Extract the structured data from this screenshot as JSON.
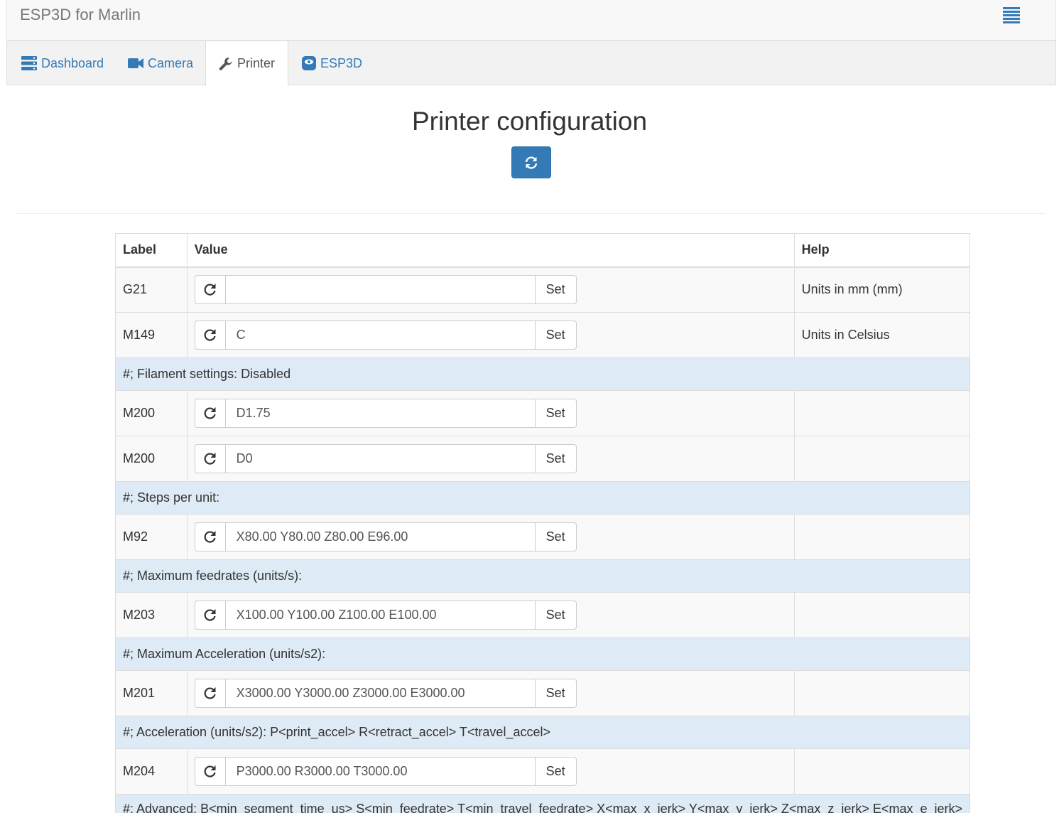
{
  "app": {
    "title": "ESP3D for Marlin",
    "menu_icon": "hamburger-menu-icon"
  },
  "tabs": [
    {
      "label": "Dashboard",
      "icon": "dashboard-icon",
      "active": false
    },
    {
      "label": "Camera",
      "icon": "camera-icon",
      "active": false
    },
    {
      "label": "Printer",
      "icon": "wrench-icon",
      "active": true
    },
    {
      "label": "ESP3D",
      "icon": "esp3d-icon",
      "active": false
    }
  ],
  "page": {
    "title": "Printer configuration",
    "refresh_icon": "refresh-icon"
  },
  "table": {
    "headers": {
      "label": "Label",
      "value": "Value",
      "help": "Help"
    },
    "set_label": "Set",
    "rows": [
      {
        "type": "setting",
        "label": "G21",
        "value": "",
        "help": "Units in mm (mm)"
      },
      {
        "type": "setting",
        "label": "M149",
        "value": "C",
        "help": "Units in Celsius"
      },
      {
        "type": "section",
        "text": "#; Filament settings: Disabled"
      },
      {
        "type": "setting",
        "label": "M200",
        "value": "D1.75",
        "help": ""
      },
      {
        "type": "setting",
        "label": "M200",
        "value": "D0",
        "help": ""
      },
      {
        "type": "section",
        "text": "#; Steps per unit:"
      },
      {
        "type": "setting",
        "label": "M92",
        "value": "X80.00 Y80.00 Z80.00 E96.00",
        "help": ""
      },
      {
        "type": "section",
        "text": "#; Maximum feedrates (units/s):"
      },
      {
        "type": "setting",
        "label": "M203",
        "value": "X100.00 Y100.00 Z100.00 E100.00",
        "help": ""
      },
      {
        "type": "section",
        "text": "#; Maximum Acceleration (units/s2):"
      },
      {
        "type": "setting",
        "label": "M201",
        "value": "X3000.00 Y3000.00 Z3000.00 E3000.00",
        "help": ""
      },
      {
        "type": "section",
        "text": "#; Acceleration (units/s2): P<print_accel> R<retract_accel> T<travel_accel>"
      },
      {
        "type": "setting",
        "label": "M204",
        "value": "P3000.00 R3000.00 T3000.00",
        "help": ""
      },
      {
        "type": "section",
        "text": "#; Advanced: B<min_segment_time_us> S<min_feedrate> T<min_travel_feedrate> X<max_x_jerk> Y<max_y_jerk> Z<max_z_jerk> E<max_e_jerk>"
      }
    ]
  },
  "colors": {
    "primary": "#337ab7",
    "section_bg": "#deeaf5",
    "stripe_bg": "#f9f9f9"
  }
}
